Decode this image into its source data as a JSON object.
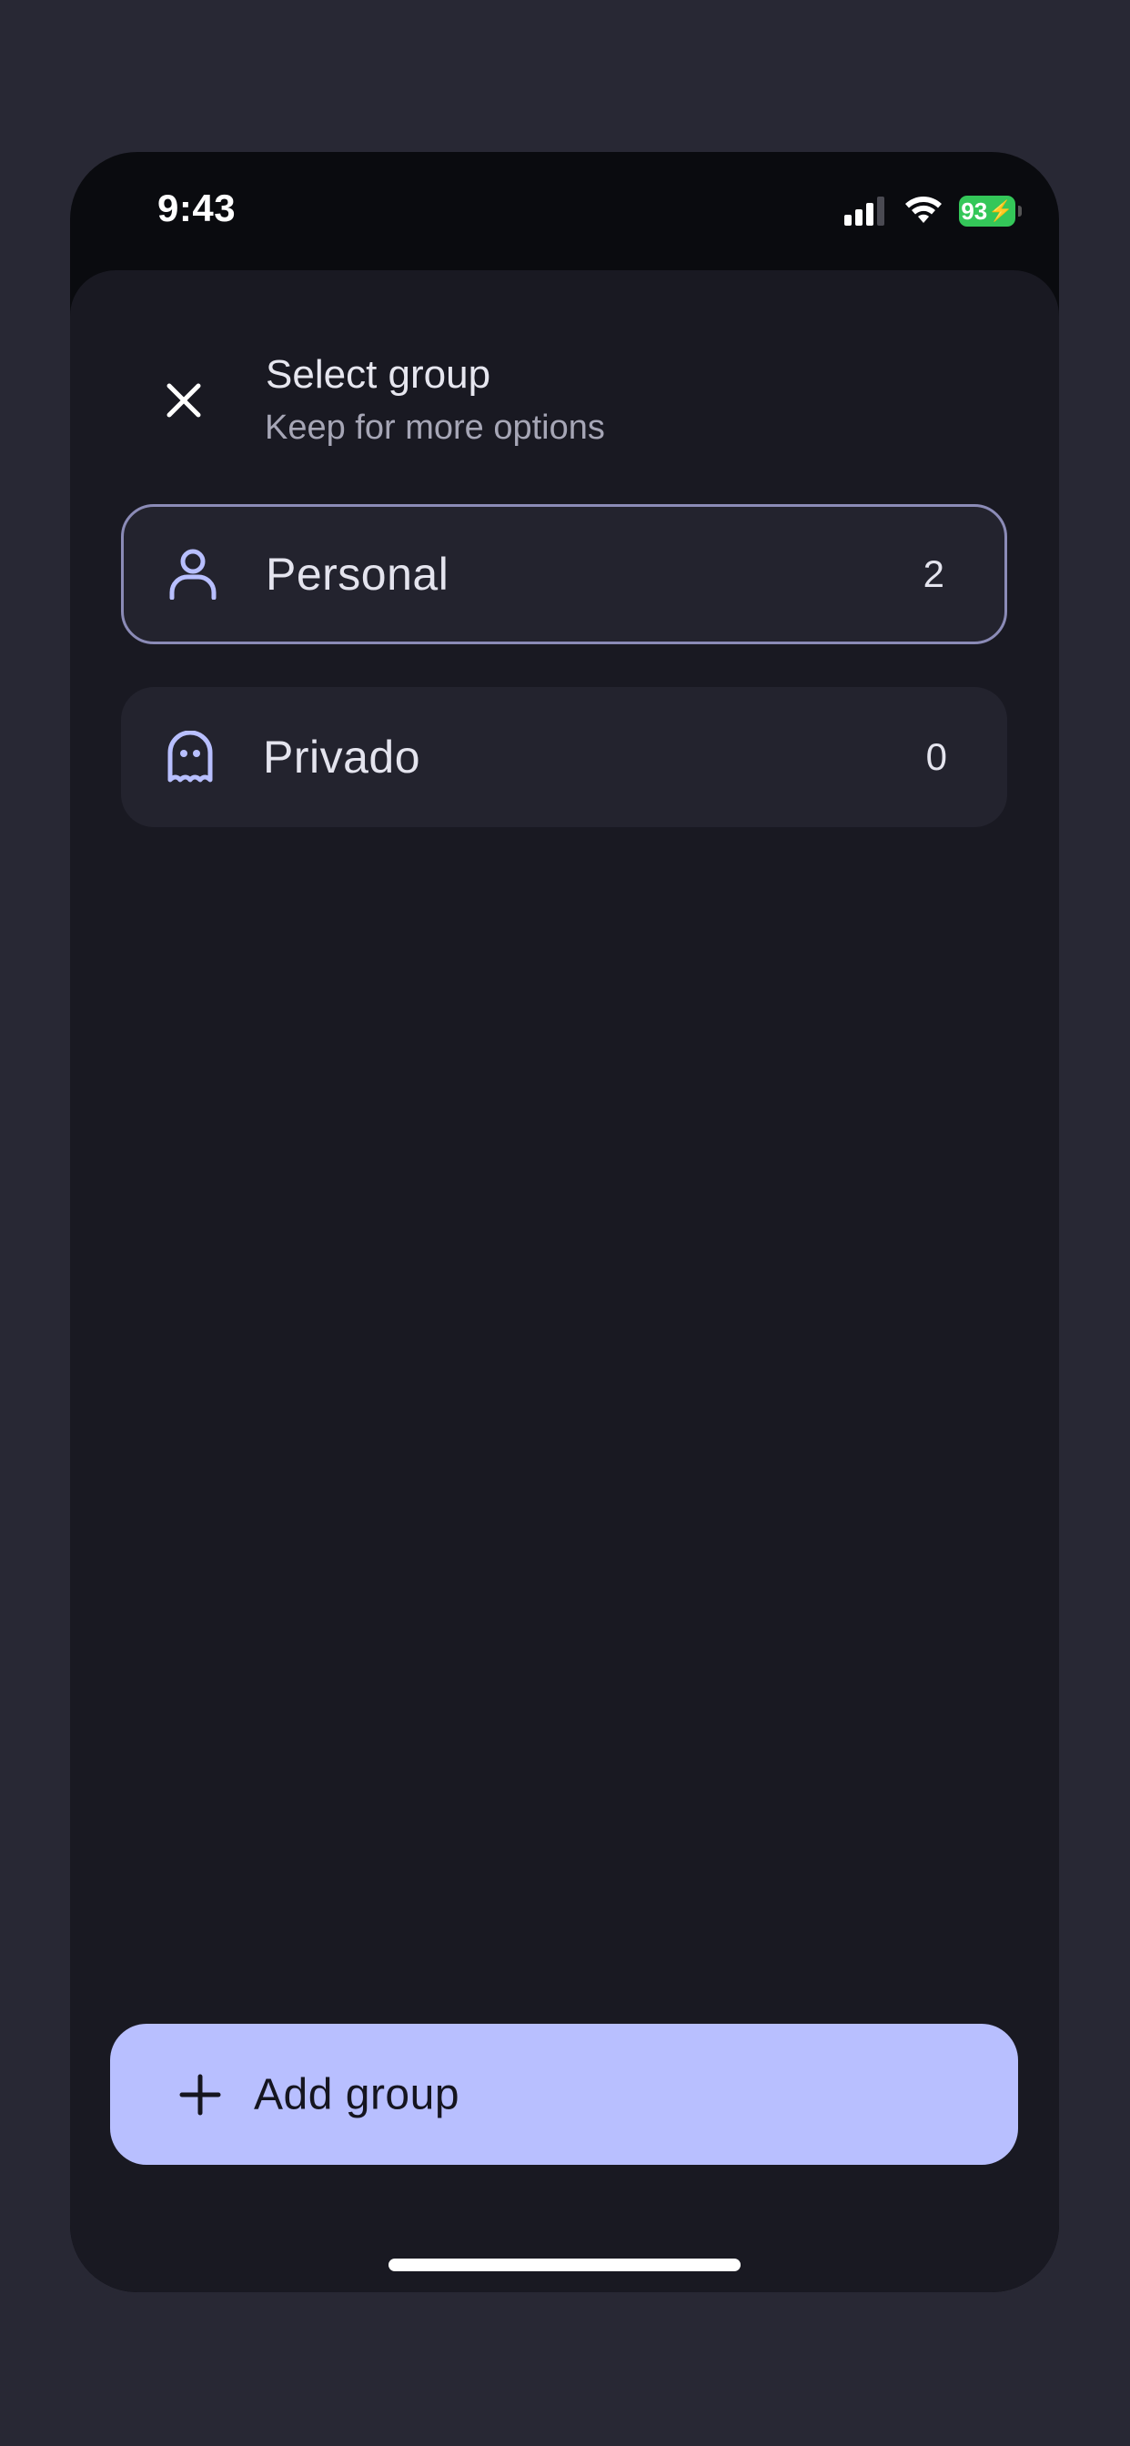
{
  "status_bar": {
    "time": "9:43",
    "battery": "93",
    "battery_color": "#34c759"
  },
  "header": {
    "close_icon": "close-icon",
    "title": "Select group",
    "subtitle": "Keep for more options"
  },
  "groups": [
    {
      "label": "Personal",
      "count": "2",
      "icon": "person-icon",
      "selected": true
    },
    {
      "label": "Privado",
      "count": "0",
      "icon": "ghost-icon",
      "selected": false
    }
  ],
  "add_button": {
    "label": "Add group",
    "icon": "plus-icon",
    "color": "#b8bfff"
  },
  "colors": {
    "background": "#282834",
    "sheet": "#191922",
    "card": "#23232e",
    "accent": "#b8bfff",
    "selected_border": "#8b8bb7"
  }
}
